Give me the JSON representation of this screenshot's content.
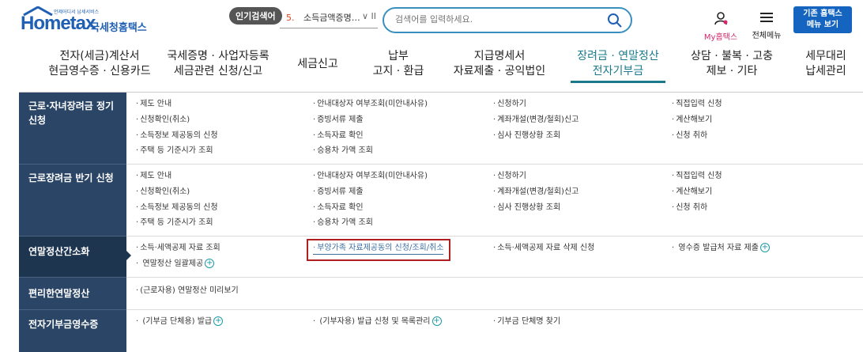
{
  "header": {
    "logo_text": "Hometax",
    "logo_tiny": "언제어디서 납세서비스",
    "logo_sub": "국세청홈택스",
    "popular_label": "인기검색어",
    "popular_rank": "5.",
    "popular_term": "소득금액증명…",
    "popular_ctrl": "∨ II",
    "search_placeholder": "검색어를 입력하세요.",
    "myhometax_label": "My홈택스",
    "allmenu_label": "전체메뉴",
    "oldmenu_label": "기존 홈택스\n메뉴 보기"
  },
  "gnb": [
    {
      "label": "전자(세금)계산서\n현금영수증 · 신용카드",
      "active": false
    },
    {
      "label": "국세증명 · 사업자등록\n세금관련 신청/신고",
      "active": false
    },
    {
      "label": "세금신고",
      "active": false
    },
    {
      "label": "납부\n고지 · 환급",
      "active": false
    },
    {
      "label": "지급명세서\n자료제출 · 공익법인",
      "active": false
    },
    {
      "label": "장려금 · 연말정산\n전자기부금",
      "active": true
    },
    {
      "label": "상담 · 불복 · 고충\n제보 · 기타",
      "active": false
    },
    {
      "label": "세무대리\n납세관리",
      "active": false
    }
  ],
  "sections": [
    {
      "category": "근로·자녀장려금 정기\n신청",
      "items": [
        "제도 안내",
        "안내대상자 여부조회(미안내사유)",
        "신청하기",
        "직접입력 신청",
        "신청확인(취소)",
        "증빙서류 제출",
        "계좌개설(변경/철회)신고",
        "계산해보기",
        "소득정보 제공동의 신청",
        "소득자료 확인",
        "심사 진행상황 조회",
        "신청 취하",
        "주택 등 기준시가 조회",
        "승용차 가액 조회"
      ]
    },
    {
      "category": "근로장려금 반기 신청",
      "items": [
        "제도 안내",
        "안내대상자 여부조회(미안내사유)",
        "신청하기",
        "직접입력 신청",
        "신청확인(취소)",
        "증빙서류 제출",
        "계좌개설(변경/철회)신고",
        "계산해보기",
        "소득정보 제공동의 신청",
        "소득자료 확인",
        "심사 진행상황 조회",
        "신청 취하",
        "주택 등 기준시가 조회",
        "승용차 가액 조회"
      ]
    },
    {
      "category": "연말정산간소화",
      "items": [
        "소득·세액공제 자료 조회",
        "부양가족 자료제공동의 신청/조회/취소",
        "소득·세액공제 자료 삭제 신청",
        "영수증 발급처 자료 제출",
        "연말정산 일괄제공"
      ]
    },
    {
      "category": "편리한연말정산",
      "items": [
        "(근로자용) 연말정산 미리보기"
      ]
    },
    {
      "category": "전자기부금영수증",
      "items": [
        "(기부금 단체용) 발급",
        "(기부자용) 발급 신청 및 목록관리",
        "기부금 단체명 찾기"
      ]
    }
  ],
  "colors": {
    "brand_blue": "#1f5fb4",
    "category_bg": "#2b4566",
    "active_teal": "#1a7a8c",
    "highlight_red": "#b02020",
    "plus_teal": "#1e9aa8"
  }
}
